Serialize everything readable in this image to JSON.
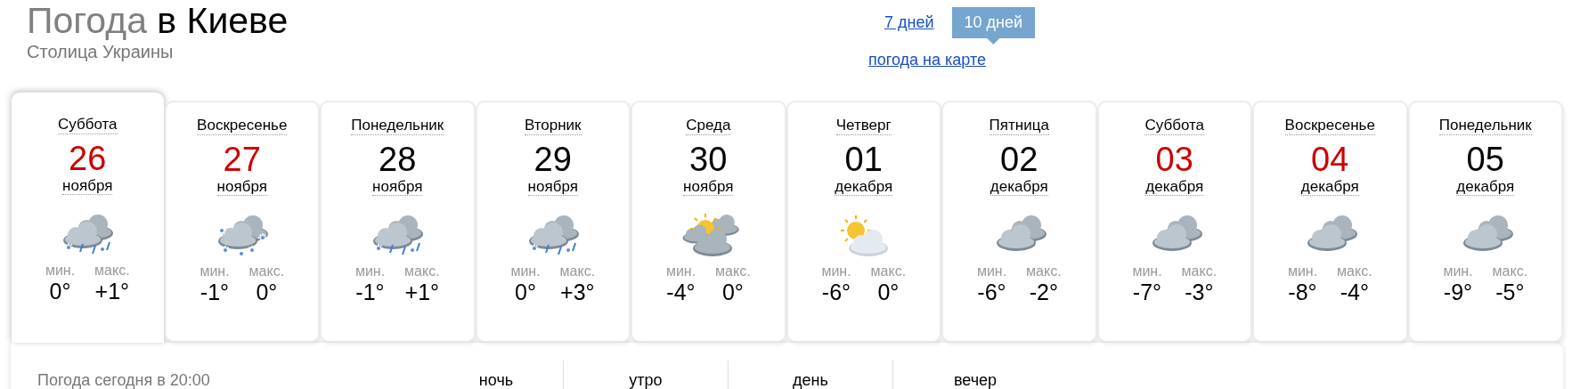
{
  "header": {
    "title_prefix": "Погода",
    "title_city": "в Киеве",
    "subtitle": "Столица Украины"
  },
  "periods": [
    {
      "label": "7 дней",
      "selected": false
    },
    {
      "label": "10 дней",
      "selected": true
    }
  ],
  "map_link": "погода на карте",
  "days": [
    {
      "weekday": "Суббота",
      "date": "26",
      "month": "ноября",
      "weekend": true,
      "selected": true,
      "kind": "snow-rain",
      "min_label": "мин.",
      "min": "0°",
      "max_label": "макс.",
      "max": "+1°"
    },
    {
      "weekday": "Воскресенье",
      "date": "27",
      "month": "ноября",
      "weekend": true,
      "selected": false,
      "kind": "snow",
      "min_label": "мин.",
      "min": "-1°",
      "max_label": "макс.",
      "max": "0°"
    },
    {
      "weekday": "Понедельник",
      "date": "28",
      "month": "ноября",
      "weekend": false,
      "selected": false,
      "kind": "snow-rain",
      "min_label": "мин.",
      "min": "-1°",
      "max_label": "макс.",
      "max": "+1°"
    },
    {
      "weekday": "Вторник",
      "date": "29",
      "month": "ноября",
      "weekend": false,
      "selected": false,
      "kind": "snow-rain",
      "min_label": "мин.",
      "min": "0°",
      "max_label": "макс.",
      "max": "+3°"
    },
    {
      "weekday": "Среда",
      "date": "30",
      "month": "ноября",
      "weekend": false,
      "selected": false,
      "kind": "partly-cloudy",
      "min_label": "мин.",
      "min": "-4°",
      "max_label": "макс.",
      "max": "0°"
    },
    {
      "weekday": "Четверг",
      "date": "01",
      "month": "декабря",
      "weekend": false,
      "selected": false,
      "kind": "sun-cloud",
      "min_label": "мин.",
      "min": "-6°",
      "max_label": "макс.",
      "max": "0°"
    },
    {
      "weekday": "Пятница",
      "date": "02",
      "month": "декабря",
      "weekend": false,
      "selected": false,
      "kind": "cloudy",
      "min_label": "мин.",
      "min": "-6°",
      "max_label": "макс.",
      "max": "-2°"
    },
    {
      "weekday": "Суббота",
      "date": "03",
      "month": "декабря",
      "weekend": true,
      "selected": false,
      "kind": "cloudy",
      "min_label": "мин.",
      "min": "-7°",
      "max_label": "макс.",
      "max": "-3°"
    },
    {
      "weekday": "Воскресенье",
      "date": "04",
      "month": "декабря",
      "weekend": true,
      "selected": false,
      "kind": "cloudy",
      "min_label": "мин.",
      "min": "-8°",
      "max_label": "макс.",
      "max": "-4°"
    },
    {
      "weekday": "Понедельник",
      "date": "05",
      "month": "декабря",
      "weekend": false,
      "selected": false,
      "kind": "cloudy",
      "min_label": "мин.",
      "min": "-9°",
      "max_label": "макс.",
      "max": "-5°"
    }
  ],
  "today": {
    "title": "Погода сегодня в 20:00",
    "columns": [
      "ночь",
      "утро",
      "день",
      "вечер"
    ]
  }
}
